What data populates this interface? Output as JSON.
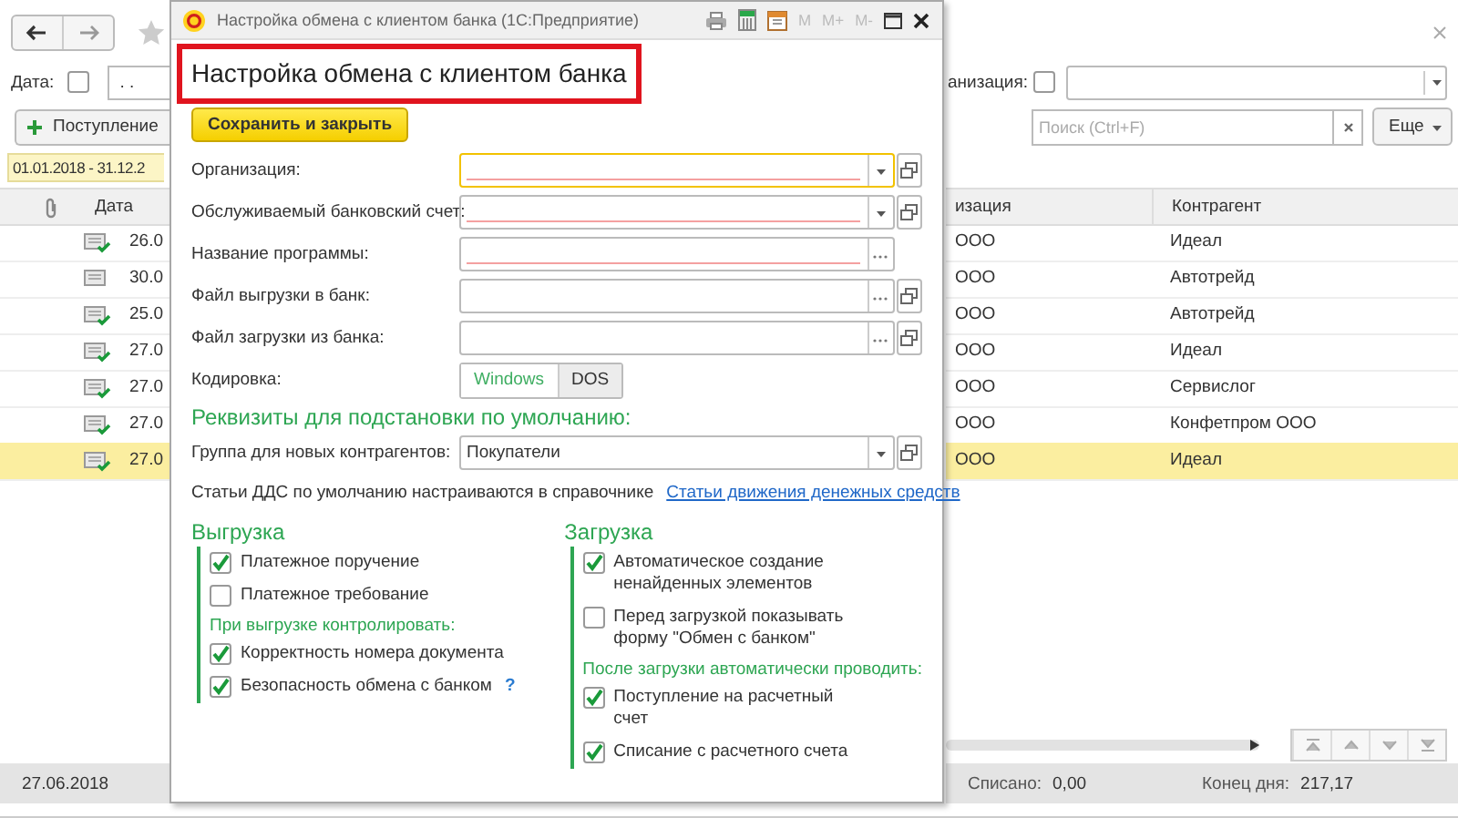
{
  "list_form": {
    "filters": [
      {
        "label": "Дата:",
        "checked": false,
        "value": ". ."
      },
      {
        "label": "анизация:",
        "checked": false
      }
    ],
    "create_button": "Поступление",
    "search": {
      "placeholder": "Поиск (Ctrl+F)"
    },
    "more_button": "Еще",
    "period": "01.01.2018 - 31.12.2",
    "table": {
      "columns": [
        "Дата",
        "изация",
        "Контрагент"
      ],
      "rows": [
        {
          "date": "26.0",
          "posted": true,
          "organization": "ООО",
          "counterparty": "Идеал",
          "selected": false
        },
        {
          "date": "30.0",
          "posted": false,
          "organization": "ООО",
          "counterparty": "Автотрейд",
          "selected": false
        },
        {
          "date": "25.0",
          "posted": true,
          "organization": "ООО",
          "counterparty": "Автотрейд",
          "selected": false
        },
        {
          "date": "27.0",
          "posted": true,
          "organization": "ООО",
          "counterparty": "Идеал",
          "selected": false
        },
        {
          "date": "27.0",
          "posted": true,
          "organization": "ООО",
          "counterparty": "Сервислог",
          "selected": false
        },
        {
          "date": "27.0",
          "posted": true,
          "organization": "ООО",
          "counterparty": "Конфетпром ООО",
          "selected": false
        },
        {
          "date": "27.0",
          "posted": true,
          "organization": "ООО",
          "counterparty": "Идеал",
          "selected": true
        }
      ]
    },
    "footer": {
      "date": "27.06.2018",
      "totals": [
        {
          "label": "Списано:",
          "value": "0,00"
        },
        {
          "label": "Конец дня:",
          "value": "217,17"
        }
      ]
    }
  },
  "dialog": {
    "title": "Настройка обмена с клиентом банка  (1С:Предприятие)",
    "memory_buttons": [
      "M",
      "M+",
      "M-"
    ],
    "heading": "Настройка обмена с клиентом банка",
    "heading_highlighted": true,
    "save_button": "Сохранить и закрыть",
    "fields": [
      {
        "label": "Организация:",
        "focused": true,
        "required": true,
        "dropdown": true,
        "choose": false,
        "open": true
      },
      {
        "label": "Обслуживаемый банковский счет:",
        "focused": false,
        "required": true,
        "dropdown": true,
        "choose": false,
        "open": true
      },
      {
        "label": "Название программы:",
        "focused": false,
        "required": true,
        "dropdown": false,
        "choose": true,
        "open": false
      },
      {
        "label": "Файл выгрузки в банк:",
        "focused": false,
        "required": false,
        "dropdown": false,
        "choose": true,
        "open": true
      },
      {
        "label": "Файл загрузки из банка:",
        "focused": false,
        "required": false,
        "dropdown": false,
        "choose": true,
        "open": true
      }
    ],
    "encoding": {
      "label": "Кодировка:",
      "options": [
        {
          "label": "Windows",
          "selected": true
        },
        {
          "label": "DOS",
          "selected": false
        }
      ]
    },
    "defaults": {
      "title": "Реквизиты для подстановки по умолчанию:",
      "field": {
        "label": "Группа для новых контрагентов:",
        "value": "Покупатели",
        "focused": false,
        "required": false,
        "dropdown": true,
        "choose": false,
        "open": true
      },
      "note": "Статьи ДДС по умолчанию настраиваются в справочнике",
      "link": "Статьи движения денежных средств"
    },
    "groups": [
      {
        "title": "Выгрузка",
        "items": [
          {
            "kind": "checkbox",
            "label": "Платежное поручение",
            "checked": true
          },
          {
            "kind": "checkbox",
            "label": "Платежное требование",
            "checked": false
          },
          {
            "kind": "subheading",
            "label": "При выгрузке контролировать:"
          },
          {
            "kind": "checkbox",
            "label": "Корректность номера документа",
            "checked": true
          },
          {
            "kind": "checkbox",
            "label": "Безопасность обмена с банком",
            "checked": true,
            "help": "?"
          }
        ]
      },
      {
        "title": "Загрузка",
        "items": [
          {
            "kind": "checkbox",
            "label": "Автоматическое создание ненайденных элементов",
            "checked": true
          },
          {
            "kind": "checkbox",
            "label": "Перед загрузкой показывать форму \"Обмен с банком\"",
            "checked": false
          },
          {
            "kind": "subheading",
            "label": "После загрузки автоматически проводить:"
          },
          {
            "kind": "checkbox",
            "label": "Поступление на расчетный счет",
            "checked": true
          },
          {
            "kind": "checkbox",
            "label": "Списание с расчетного счета",
            "checked": true
          }
        ]
      }
    ]
  }
}
